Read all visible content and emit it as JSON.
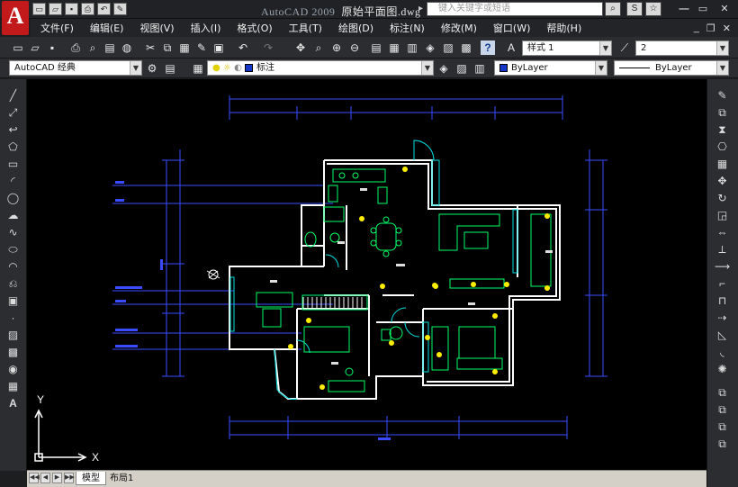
{
  "app": {
    "logo": "A",
    "title_prefix": "AutoCAD 2009",
    "file_name": "原始平面图.dwg",
    "search_placeholder": "键入关键字或短语"
  },
  "menu": [
    "文件(F)",
    "编辑(E)",
    "视图(V)",
    "插入(I)",
    "格式(O)",
    "工具(T)",
    "绘图(D)",
    "标注(N)",
    "修改(M)",
    "窗口(W)",
    "帮助(H)"
  ],
  "toolbar": {
    "text_style": "样式 1",
    "dim_scale": "2",
    "workspace": "AutoCAD 经典",
    "layer": "标注",
    "color": "ByLayer",
    "linetype": "ByLayer"
  },
  "ucs": {
    "x_label": "X",
    "y_label": "Y"
  },
  "tabs": {
    "model": "模型",
    "layout": "布局1"
  },
  "colors": {
    "background": "#000000",
    "walls": "#ffffff",
    "furniture": "#00ff66",
    "dimensions": "#3a4bff",
    "doors": "#00e0e0",
    "lights": "#ffff00"
  }
}
